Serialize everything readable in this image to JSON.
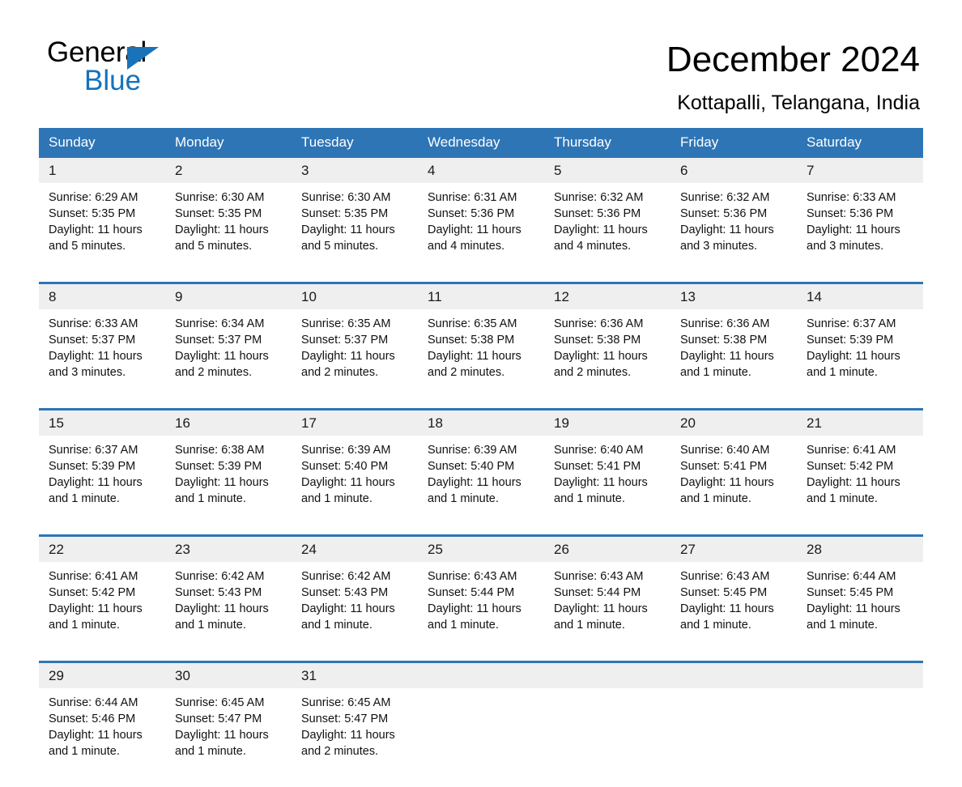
{
  "brand": {
    "name_part1": "General",
    "name_part2": "Blue",
    "triangle_color": "#1a72b8",
    "blue_color": "#1572bd"
  },
  "header": {
    "month_title": "December 2024",
    "location": "Kottapalli, Telangana, India",
    "accent_color": "#2e75b6",
    "daynum_band_color": "#efefef"
  },
  "weekday_headers": [
    "Sunday",
    "Monday",
    "Tuesday",
    "Wednesday",
    "Thursday",
    "Friday",
    "Saturday"
  ],
  "weeks": [
    {
      "days": [
        {
          "number": "1",
          "sunrise": "Sunrise: 6:29 AM",
          "sunset": "Sunset: 5:35 PM",
          "daylight": "Daylight: 11 hours and 5 minutes."
        },
        {
          "number": "2",
          "sunrise": "Sunrise: 6:30 AM",
          "sunset": "Sunset: 5:35 PM",
          "daylight": "Daylight: 11 hours and 5 minutes."
        },
        {
          "number": "3",
          "sunrise": "Sunrise: 6:30 AM",
          "sunset": "Sunset: 5:35 PM",
          "daylight": "Daylight: 11 hours and 5 minutes."
        },
        {
          "number": "4",
          "sunrise": "Sunrise: 6:31 AM",
          "sunset": "Sunset: 5:36 PM",
          "daylight": "Daylight: 11 hours and 4 minutes."
        },
        {
          "number": "5",
          "sunrise": "Sunrise: 6:32 AM",
          "sunset": "Sunset: 5:36 PM",
          "daylight": "Daylight: 11 hours and 4 minutes."
        },
        {
          "number": "6",
          "sunrise": "Sunrise: 6:32 AM",
          "sunset": "Sunset: 5:36 PM",
          "daylight": "Daylight: 11 hours and 3 minutes."
        },
        {
          "number": "7",
          "sunrise": "Sunrise: 6:33 AM",
          "sunset": "Sunset: 5:36 PM",
          "daylight": "Daylight: 11 hours and 3 minutes."
        }
      ]
    },
    {
      "days": [
        {
          "number": "8",
          "sunrise": "Sunrise: 6:33 AM",
          "sunset": "Sunset: 5:37 PM",
          "daylight": "Daylight: 11 hours and 3 minutes."
        },
        {
          "number": "9",
          "sunrise": "Sunrise: 6:34 AM",
          "sunset": "Sunset: 5:37 PM",
          "daylight": "Daylight: 11 hours and 2 minutes."
        },
        {
          "number": "10",
          "sunrise": "Sunrise: 6:35 AM",
          "sunset": "Sunset: 5:37 PM",
          "daylight": "Daylight: 11 hours and 2 minutes."
        },
        {
          "number": "11",
          "sunrise": "Sunrise: 6:35 AM",
          "sunset": "Sunset: 5:38 PM",
          "daylight": "Daylight: 11 hours and 2 minutes."
        },
        {
          "number": "12",
          "sunrise": "Sunrise: 6:36 AM",
          "sunset": "Sunset: 5:38 PM",
          "daylight": "Daylight: 11 hours and 2 minutes."
        },
        {
          "number": "13",
          "sunrise": "Sunrise: 6:36 AM",
          "sunset": "Sunset: 5:38 PM",
          "daylight": "Daylight: 11 hours and 1 minute."
        },
        {
          "number": "14",
          "sunrise": "Sunrise: 6:37 AM",
          "sunset": "Sunset: 5:39 PM",
          "daylight": "Daylight: 11 hours and 1 minute."
        }
      ]
    },
    {
      "days": [
        {
          "number": "15",
          "sunrise": "Sunrise: 6:37 AM",
          "sunset": "Sunset: 5:39 PM",
          "daylight": "Daylight: 11 hours and 1 minute."
        },
        {
          "number": "16",
          "sunrise": "Sunrise: 6:38 AM",
          "sunset": "Sunset: 5:39 PM",
          "daylight": "Daylight: 11 hours and 1 minute."
        },
        {
          "number": "17",
          "sunrise": "Sunrise: 6:39 AM",
          "sunset": "Sunset: 5:40 PM",
          "daylight": "Daylight: 11 hours and 1 minute."
        },
        {
          "number": "18",
          "sunrise": "Sunrise: 6:39 AM",
          "sunset": "Sunset: 5:40 PM",
          "daylight": "Daylight: 11 hours and 1 minute."
        },
        {
          "number": "19",
          "sunrise": "Sunrise: 6:40 AM",
          "sunset": "Sunset: 5:41 PM",
          "daylight": "Daylight: 11 hours and 1 minute."
        },
        {
          "number": "20",
          "sunrise": "Sunrise: 6:40 AM",
          "sunset": "Sunset: 5:41 PM",
          "daylight": "Daylight: 11 hours and 1 minute."
        },
        {
          "number": "21",
          "sunrise": "Sunrise: 6:41 AM",
          "sunset": "Sunset: 5:42 PM",
          "daylight": "Daylight: 11 hours and 1 minute."
        }
      ]
    },
    {
      "days": [
        {
          "number": "22",
          "sunrise": "Sunrise: 6:41 AM",
          "sunset": "Sunset: 5:42 PM",
          "daylight": "Daylight: 11 hours and 1 minute."
        },
        {
          "number": "23",
          "sunrise": "Sunrise: 6:42 AM",
          "sunset": "Sunset: 5:43 PM",
          "daylight": "Daylight: 11 hours and 1 minute."
        },
        {
          "number": "24",
          "sunrise": "Sunrise: 6:42 AM",
          "sunset": "Sunset: 5:43 PM",
          "daylight": "Daylight: 11 hours and 1 minute."
        },
        {
          "number": "25",
          "sunrise": "Sunrise: 6:43 AM",
          "sunset": "Sunset: 5:44 PM",
          "daylight": "Daylight: 11 hours and 1 minute."
        },
        {
          "number": "26",
          "sunrise": "Sunrise: 6:43 AM",
          "sunset": "Sunset: 5:44 PM",
          "daylight": "Daylight: 11 hours and 1 minute."
        },
        {
          "number": "27",
          "sunrise": "Sunrise: 6:43 AM",
          "sunset": "Sunset: 5:45 PM",
          "daylight": "Daylight: 11 hours and 1 minute."
        },
        {
          "number": "28",
          "sunrise": "Sunrise: 6:44 AM",
          "sunset": "Sunset: 5:45 PM",
          "daylight": "Daylight: 11 hours and 1 minute."
        }
      ]
    },
    {
      "days": [
        {
          "number": "29",
          "sunrise": "Sunrise: 6:44 AM",
          "sunset": "Sunset: 5:46 PM",
          "daylight": "Daylight: 11 hours and 1 minute."
        },
        {
          "number": "30",
          "sunrise": "Sunrise: 6:45 AM",
          "sunset": "Sunset: 5:47 PM",
          "daylight": "Daylight: 11 hours and 1 minute."
        },
        {
          "number": "31",
          "sunrise": "Sunrise: 6:45 AM",
          "sunset": "Sunset: 5:47 PM",
          "daylight": "Daylight: 11 hours and 2 minutes."
        },
        {
          "number": "",
          "sunrise": "",
          "sunset": "",
          "daylight": ""
        },
        {
          "number": "",
          "sunrise": "",
          "sunset": "",
          "daylight": ""
        },
        {
          "number": "",
          "sunrise": "",
          "sunset": "",
          "daylight": ""
        },
        {
          "number": "",
          "sunrise": "",
          "sunset": "",
          "daylight": ""
        }
      ]
    }
  ]
}
